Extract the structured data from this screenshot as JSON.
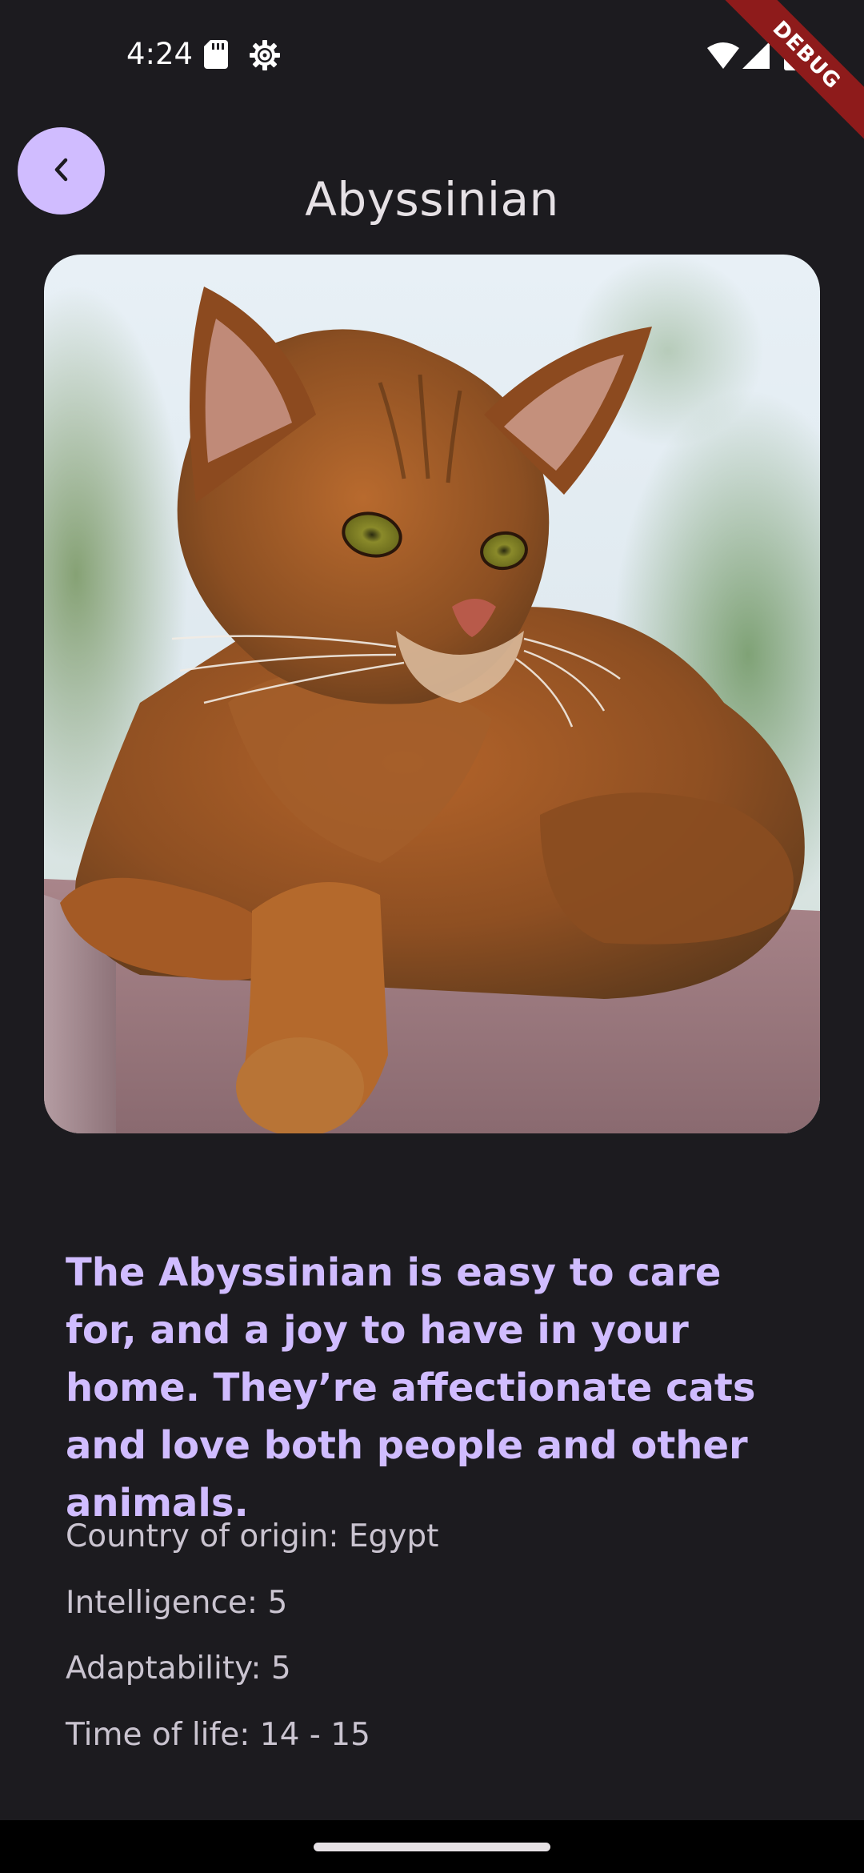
{
  "status_bar": {
    "time": "4:24",
    "left_icons": [
      "sd-card-icon",
      "settings-gear-icon"
    ],
    "right_icons": [
      "wifi-icon",
      "cellular-signal-icon",
      "battery-icon"
    ]
  },
  "debug_banner": {
    "label": "DEBUG",
    "color": "#8e1b1b"
  },
  "app_bar": {
    "back_icon": "chevron-left-icon",
    "title": "Abyssinian"
  },
  "cat": {
    "image_subject": "abyssinian-cat-photo",
    "description": "The Abyssinian is easy to care for, and a joy to have in your home. They’re affectionate cats and love both people and other animals.",
    "details": {
      "origin": "Country of origin: Egypt",
      "intelligence": "Intelligence: 5",
      "adaptability": "Adaptability: 5",
      "life_span": "Time of life: 14 - 15"
    }
  },
  "colors": {
    "background": "#1c1b1f",
    "accent": "#d0bcff",
    "title_text": "#e6e1e5",
    "body_text": "#cac4d0"
  }
}
